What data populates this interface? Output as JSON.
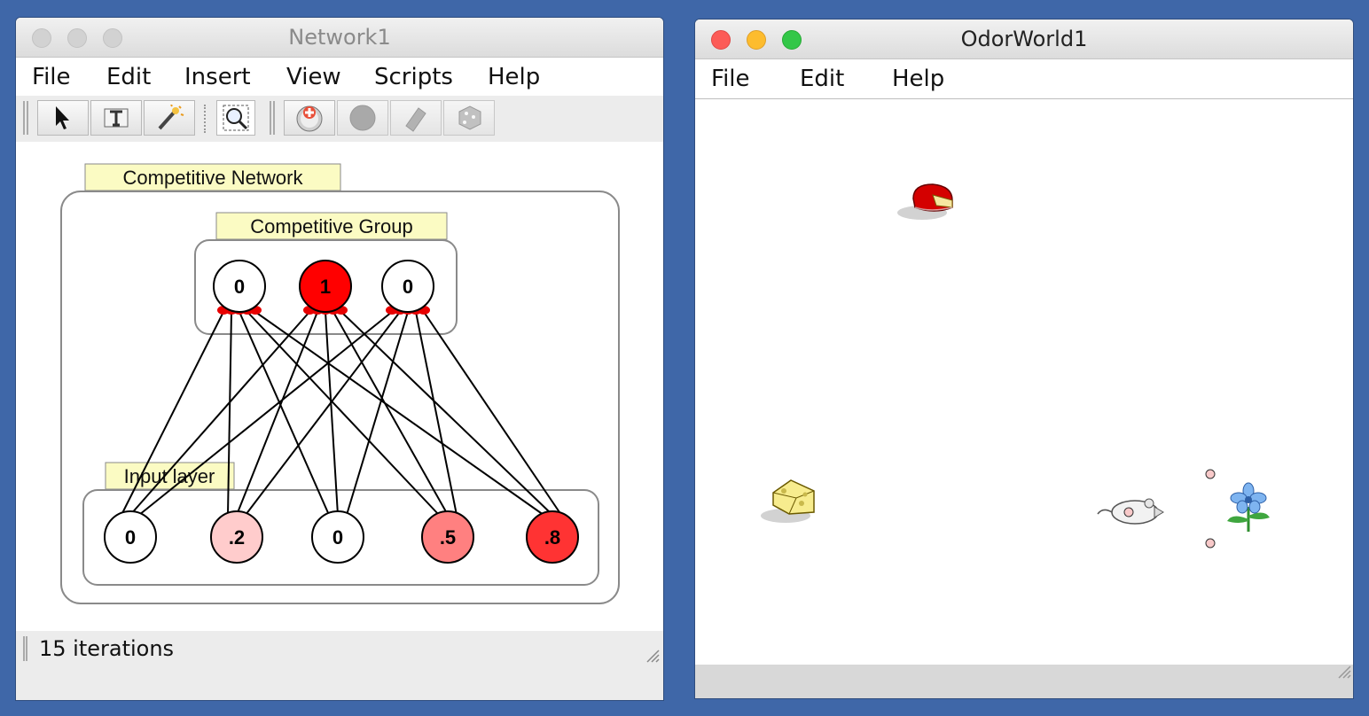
{
  "network_window": {
    "title": "Network1",
    "menu": [
      "File",
      "Edit",
      "Insert",
      "View",
      "Scripts",
      "Help"
    ],
    "toolbar_icons": [
      "select-arrow-icon",
      "text-tool-icon",
      "wand-icon",
      "zoom-fit-icon",
      "add-neuron-icon",
      "clear-neuron-icon",
      "eraser-icon",
      "randomize-icon"
    ],
    "network_label": "Competitive Network",
    "group_label": "Competitive Group",
    "input_label": "Input layer",
    "competitive_neurons": [
      {
        "label": "0",
        "activation": 0
      },
      {
        "label": "1",
        "activation": 1
      },
      {
        "label": "0",
        "activation": 0
      }
    ],
    "input_neurons": [
      {
        "label": "0",
        "activation": 0
      },
      {
        "label": ".2",
        "activation": 0.2
      },
      {
        "label": "0",
        "activation": 0
      },
      {
        "label": ".5",
        "activation": 0.5
      },
      {
        "label": ".8",
        "activation": 0.8
      }
    ],
    "status": "15 iterations"
  },
  "odor_window": {
    "title": "OdorWorld1",
    "menu": [
      "File",
      "Edit",
      "Help"
    ],
    "entities": [
      "swiss-cheese-icon",
      "red-cheese-wheel-icon",
      "mouse-agent-icon",
      "blue-flower-icon"
    ]
  },
  "colors": {
    "background": "#3f67a8",
    "active_red": "#ee0000",
    "label_fill": "#fbfbc3"
  }
}
